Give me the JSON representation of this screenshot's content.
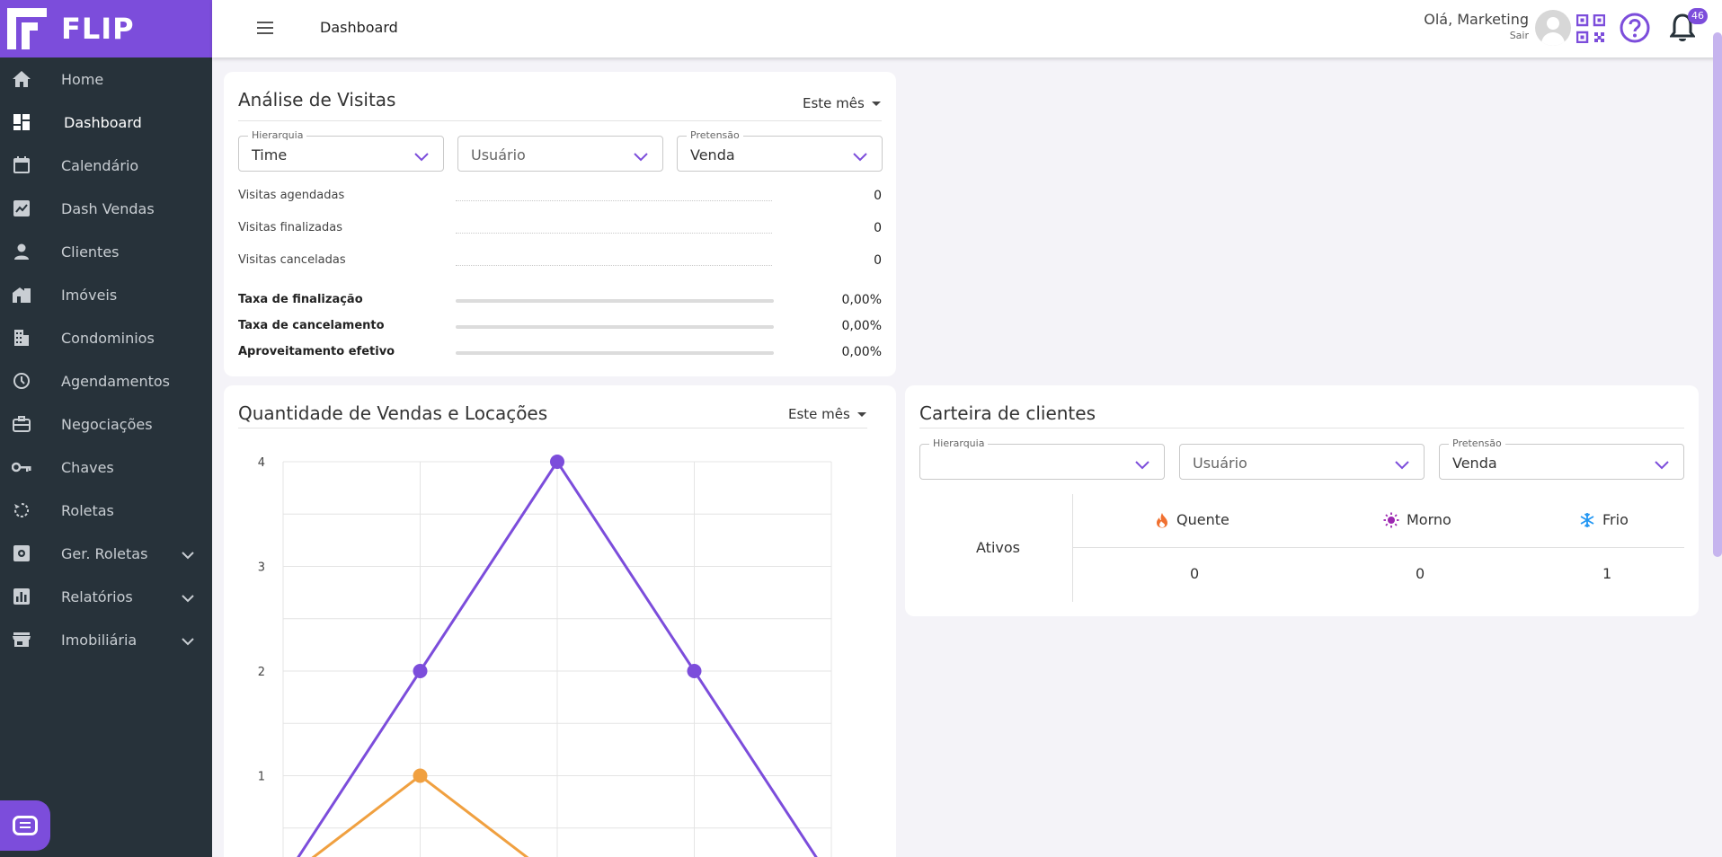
{
  "brand": {
    "name": "FLIP",
    "color": "#7c4ddb"
  },
  "sidebar": {
    "items": [
      {
        "label": "Home",
        "icon": "home-icon"
      },
      {
        "label": "Dashboard",
        "icon": "dashboard-icon",
        "active": true
      },
      {
        "label": "Calendário",
        "icon": "calendar-icon"
      },
      {
        "label": "Dash Vendas",
        "icon": "chart-icon"
      },
      {
        "label": "Clientes",
        "icon": "person-icon"
      },
      {
        "label": "Imóveis",
        "icon": "buildings-icon"
      },
      {
        "label": "Condominios",
        "icon": "building-icon"
      },
      {
        "label": "Agendamentos",
        "icon": "clock-icon"
      },
      {
        "label": "Negociações",
        "icon": "briefcase-icon"
      },
      {
        "label": "Chaves",
        "icon": "key-icon"
      },
      {
        "label": "Roletas",
        "icon": "roulette-icon"
      },
      {
        "label": "Ger. Roletas",
        "icon": "settings-icon",
        "expandable": true
      },
      {
        "label": "Relatórios",
        "icon": "report-icon",
        "expandable": true
      },
      {
        "label": "Imobiliária",
        "icon": "store-icon",
        "expandable": true
      }
    ]
  },
  "header": {
    "title": "Dashboard",
    "greeting": "Olá, Marketing",
    "logout": "Sair",
    "notifications": "46"
  },
  "visits": {
    "title": "Análise de Visitas",
    "period": "Este mês",
    "filters": {
      "hierarquia_label": "Hierarquia",
      "hierarquia_value": "Time",
      "usuario_placeholder": "Usuário",
      "pretensao_label": "Pretensão",
      "pretensao_value": "Venda"
    },
    "rows": [
      {
        "label": "Visitas agendadas",
        "value": "0"
      },
      {
        "label": "Visitas finalizadas",
        "value": "0"
      },
      {
        "label": "Visitas canceladas",
        "value": "0"
      }
    ],
    "rates": [
      {
        "label": "Taxa de finalização",
        "value": "0,00%",
        "progress": 0
      },
      {
        "label": "Taxa de cancelamento",
        "value": "0,00%",
        "progress": 0
      },
      {
        "label": "Aproveitamento efetivo",
        "value": "0,00%",
        "progress": 0
      }
    ]
  },
  "sales": {
    "title": "Quantidade de Vendas e Locações",
    "period": "Este mês"
  },
  "chart_data": {
    "type": "line",
    "x": [
      0,
      1,
      2,
      3,
      4
    ],
    "ylim": [
      0,
      4
    ],
    "yticks": [
      "1",
      "2",
      "3",
      "4"
    ],
    "grid": true,
    "series": [
      {
        "values": [
          0,
          2,
          4,
          2,
          0
        ],
        "color": "#7c4ddb"
      },
      {
        "values": [
          0,
          1,
          0,
          0,
          0
        ],
        "color": "#f0a040"
      }
    ]
  },
  "portfolio": {
    "title": "Carteira de clientes",
    "filters": {
      "hierarquia_label": "Hierarquia",
      "hierarquia_value": "",
      "usuario_placeholder": "Usuário",
      "pretensao_label": "Pretensão",
      "pretensao_value": "Venda"
    },
    "row_label": "Ativos",
    "columns": [
      {
        "label": "Quente",
        "icon": "fire-icon",
        "color": "#f07030",
        "value": "0"
      },
      {
        "label": "Morno",
        "icon": "sun-icon",
        "color": "#9c27b0",
        "value": "0"
      },
      {
        "label": "Frio",
        "icon": "snowflake-icon",
        "color": "#2196f3",
        "value": "1"
      }
    ]
  }
}
